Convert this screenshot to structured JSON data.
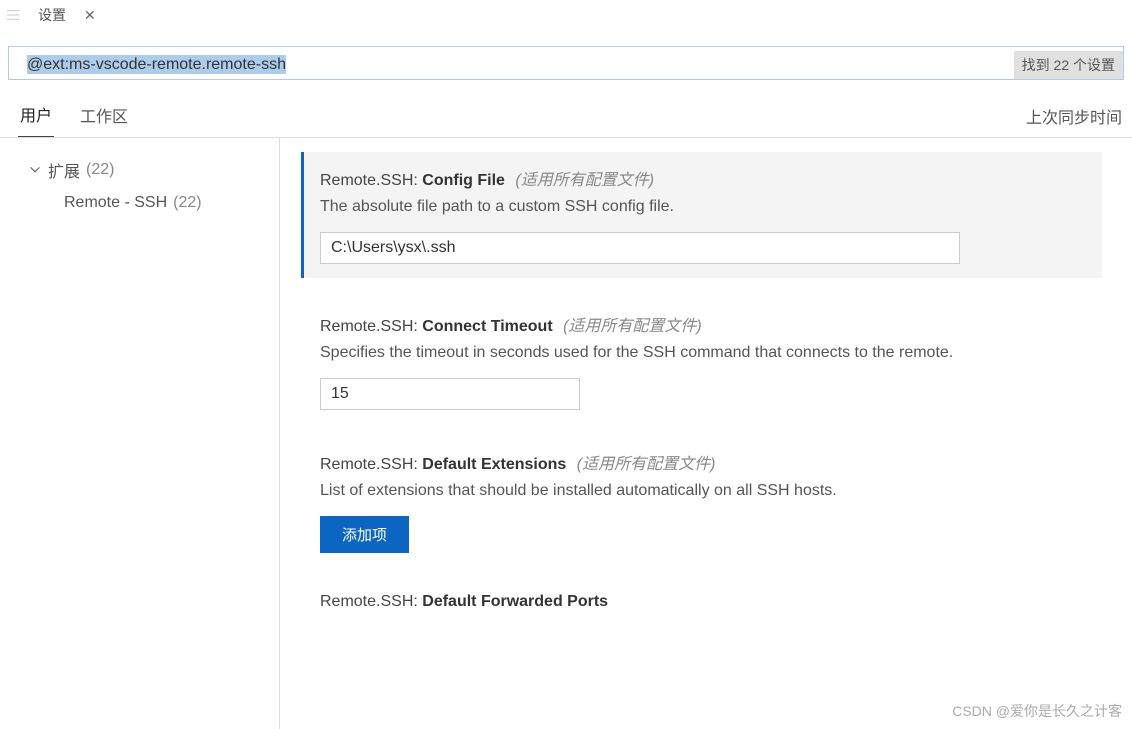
{
  "titlebar": {
    "label": "设置"
  },
  "search": {
    "value": "@ext:ms-vscode-remote.remote-ssh",
    "found_label": "找到 22 个设置"
  },
  "scope": {
    "tabs": {
      "user": "用户",
      "workspace": "工作区"
    },
    "last_sync": "上次同步时间"
  },
  "sidebar": {
    "root": "扩展",
    "root_count": "(22)",
    "child": "Remote - SSH",
    "child_count": "(22)"
  },
  "content": {
    "scope_all": "(适用所有配置文件)",
    "add_item": "添加项",
    "settings": [
      {
        "prefix": "Remote.SSH:",
        "name": "Config File",
        "desc": "The absolute file path to a custom SSH config file.",
        "value": "C:\\Users\\ysx\\.ssh"
      },
      {
        "prefix": "Remote.SSH:",
        "name": "Connect Timeout",
        "desc": "Specifies the timeout in seconds used for the SSH command that connects to the remote.",
        "value": "15"
      },
      {
        "prefix": "Remote.SSH:",
        "name": "Default Extensions",
        "desc": "List of extensions that should be installed automatically on all SSH hosts."
      },
      {
        "prefix": "Remote.SSH:",
        "name": "Default Forwarded Ports"
      }
    ]
  },
  "watermark": "CSDN @爱你是长久之计客"
}
